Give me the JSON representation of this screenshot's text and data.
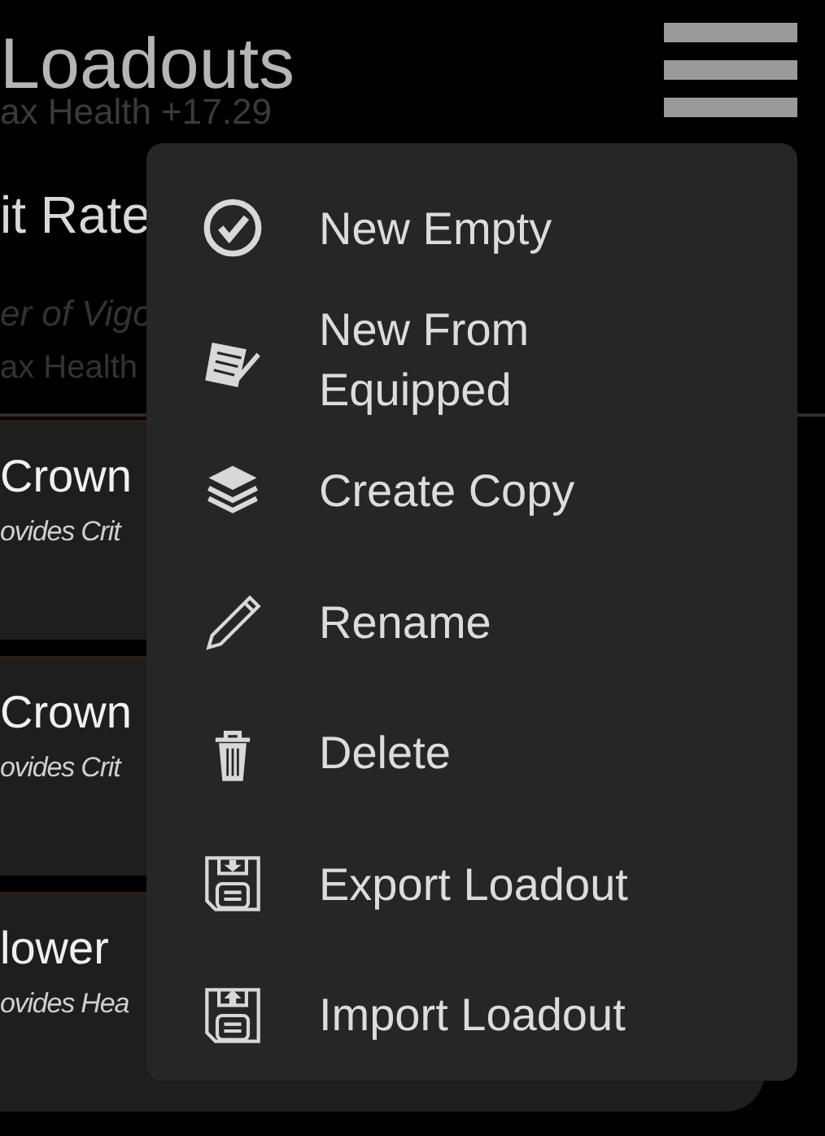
{
  "header": {
    "title": "Loadouts",
    "behind_stat": "ax Health +17.29"
  },
  "summary": {
    "heading": "it Rate",
    "subtitle": "er of Vigo",
    "stat": "ax Health"
  },
  "cards": [
    {
      "name": "Crown",
      "description": "ovides Crit"
    },
    {
      "name": "Crown",
      "description": "ovides Crit"
    },
    {
      "name": "lower",
      "description": "ovides Hea"
    }
  ],
  "menu": {
    "items": [
      {
        "label": "New Empty",
        "kind": "check-circle"
      },
      {
        "label": "New From Equipped",
        "kind": "notepad"
      },
      {
        "label": "Create Copy",
        "kind": "layers"
      },
      {
        "label": "Rename",
        "kind": "pencil"
      },
      {
        "label": "Delete",
        "kind": "trash"
      },
      {
        "label": "Export Loadout",
        "kind": "floppy-down"
      },
      {
        "label": "Import Loadout",
        "kind": "floppy-up"
      }
    ]
  }
}
